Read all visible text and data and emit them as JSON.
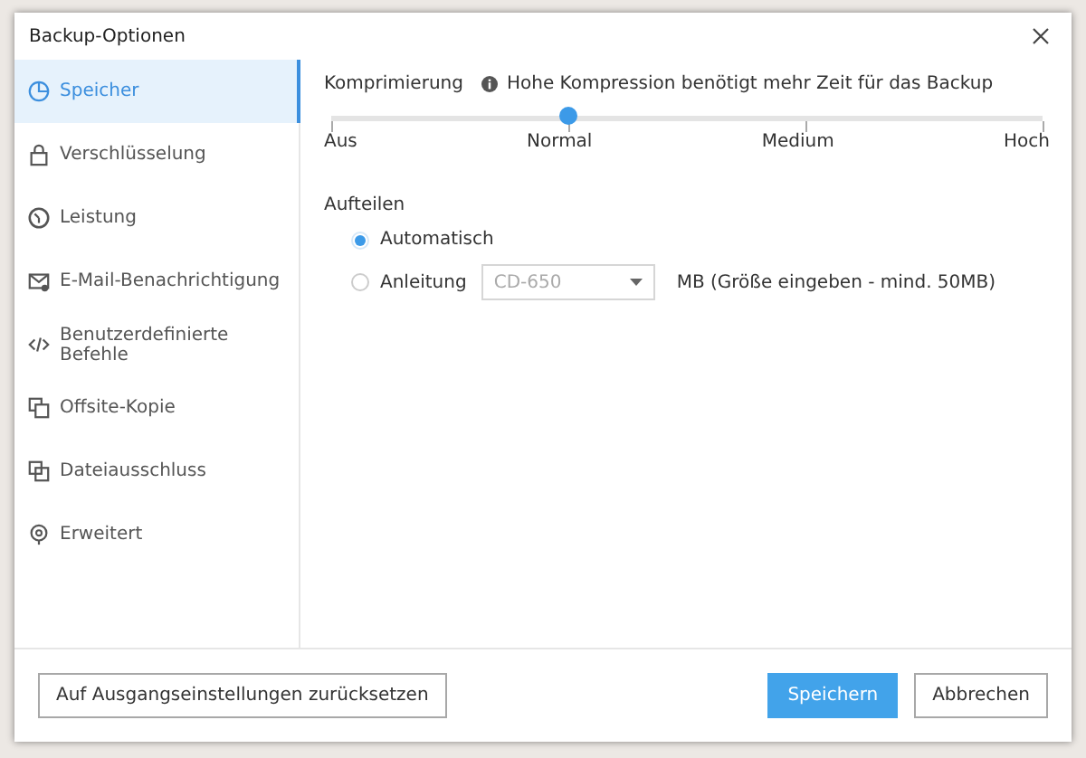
{
  "window": {
    "title": "Backup-Optionen"
  },
  "sidebar": {
    "items": [
      {
        "label": "Speicher",
        "selected": true
      },
      {
        "label": "Verschlüsselung",
        "selected": false
      },
      {
        "label": "Leistung",
        "selected": false
      },
      {
        "label": "E-Mail-Benachrichtigung",
        "selected": false
      },
      {
        "label": "Benutzerdefinierte Befehle",
        "selected": false
      },
      {
        "label": "Offsite-Kopie",
        "selected": false
      },
      {
        "label": "Dateiausschluss",
        "selected": false
      },
      {
        "label": "Erweitert",
        "selected": false
      }
    ]
  },
  "compression": {
    "label": "Komprimierung",
    "info": "Hohe Kompression benötigt mehr Zeit für das Backup",
    "level": 0.3333,
    "stops": [
      "Aus",
      "Normal",
      "Medium",
      "Hoch"
    ]
  },
  "split": {
    "label": "Aufteilen",
    "options": [
      {
        "kind": "plain",
        "label": "Automatisch",
        "selected": true
      },
      {
        "kind": "size",
        "label": "Anleitung",
        "selected": false,
        "dropdown": {
          "value": "CD-650",
          "disabled": true
        },
        "hint": "MB (Größe eingeben - mind. 50MB)"
      }
    ]
  },
  "buttons": [
    {
      "kind": "secondary",
      "label": "Auf Ausgangseinstellungen zurücksetzen"
    },
    {
      "kind": "primary",
      "label": "Speichern"
    },
    {
      "kind": "secondary",
      "label": "Abbrechen"
    }
  ]
}
